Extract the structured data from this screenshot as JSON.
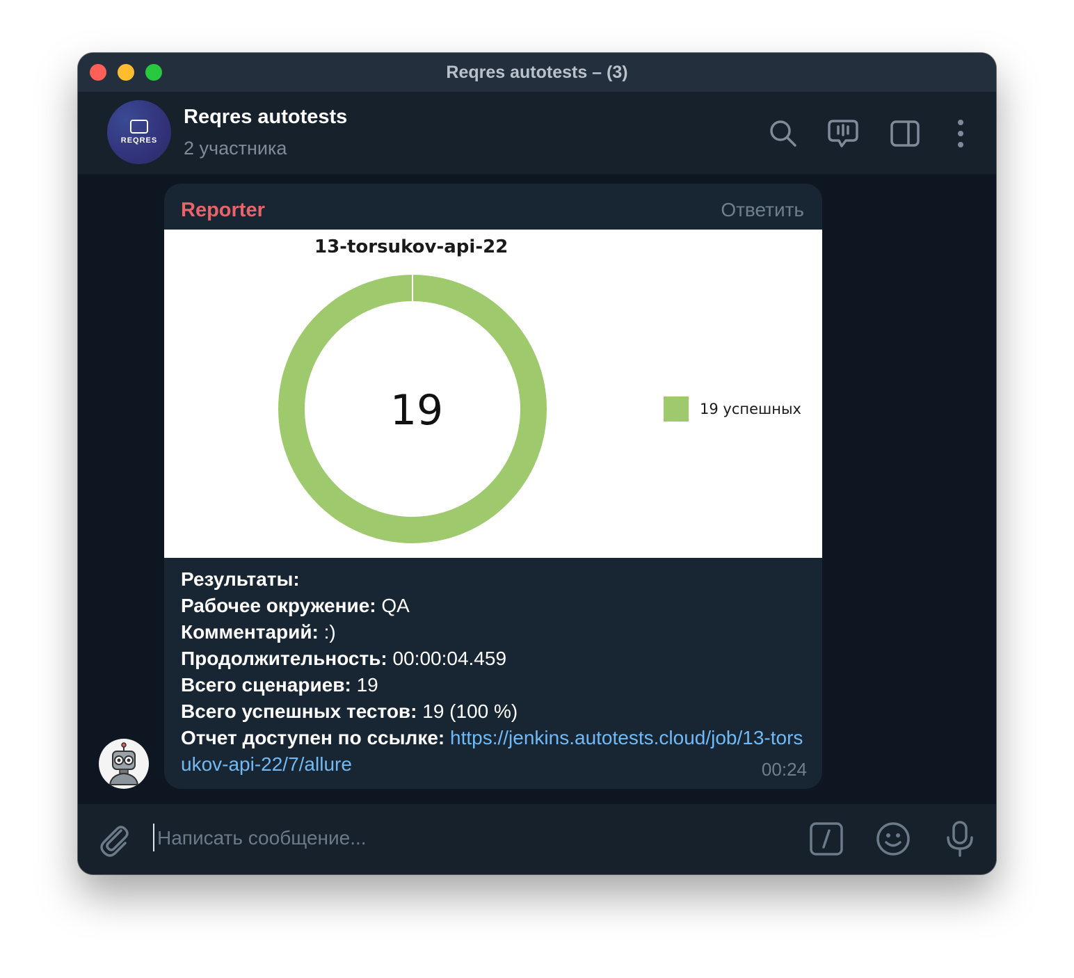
{
  "window": {
    "title": "Reqres autotests – (3)"
  },
  "chat": {
    "name": "Reqres autotests",
    "subtitle": "2 участника",
    "avatar_text": "REQRES"
  },
  "header_icons": [
    "search-icon",
    "live-chat-icon",
    "sidebar-toggle-icon",
    "more-vert-icon"
  ],
  "message": {
    "sender": "Reporter",
    "reply_label": "Ответить",
    "time": "00:24",
    "lines": [
      {
        "label": "Результаты:",
        "value": ""
      },
      {
        "label": "Рабочее окружение:",
        "value": " QA"
      },
      {
        "label": "Комментарий:",
        "value": " :)"
      },
      {
        "label": "Продолжительность:",
        "value": " 00:00:04.459"
      },
      {
        "label": "Всего сценариев:",
        "value": " 19"
      },
      {
        "label": "Всего успешных тестов:",
        "value": " 19 (100 %)"
      },
      {
        "label": "Отчет доступен по ссылке:",
        "value": " "
      }
    ],
    "link": "https://jenkins.autotests.cloud/job/13-torsukov-api-22/7/allure"
  },
  "composer": {
    "placeholder": "Написать сообщение..."
  },
  "colors": {
    "accent_sender": "#e96468",
    "link": "#71baf5",
    "passed": "#9ec96d"
  },
  "chart_data": {
    "type": "pie",
    "title": "13-torsukov-api-22",
    "center_label": "19",
    "categories": [
      "19 успешных"
    ],
    "values": [
      19
    ],
    "colors": [
      "#9ec96d"
    ],
    "legend": "right"
  }
}
